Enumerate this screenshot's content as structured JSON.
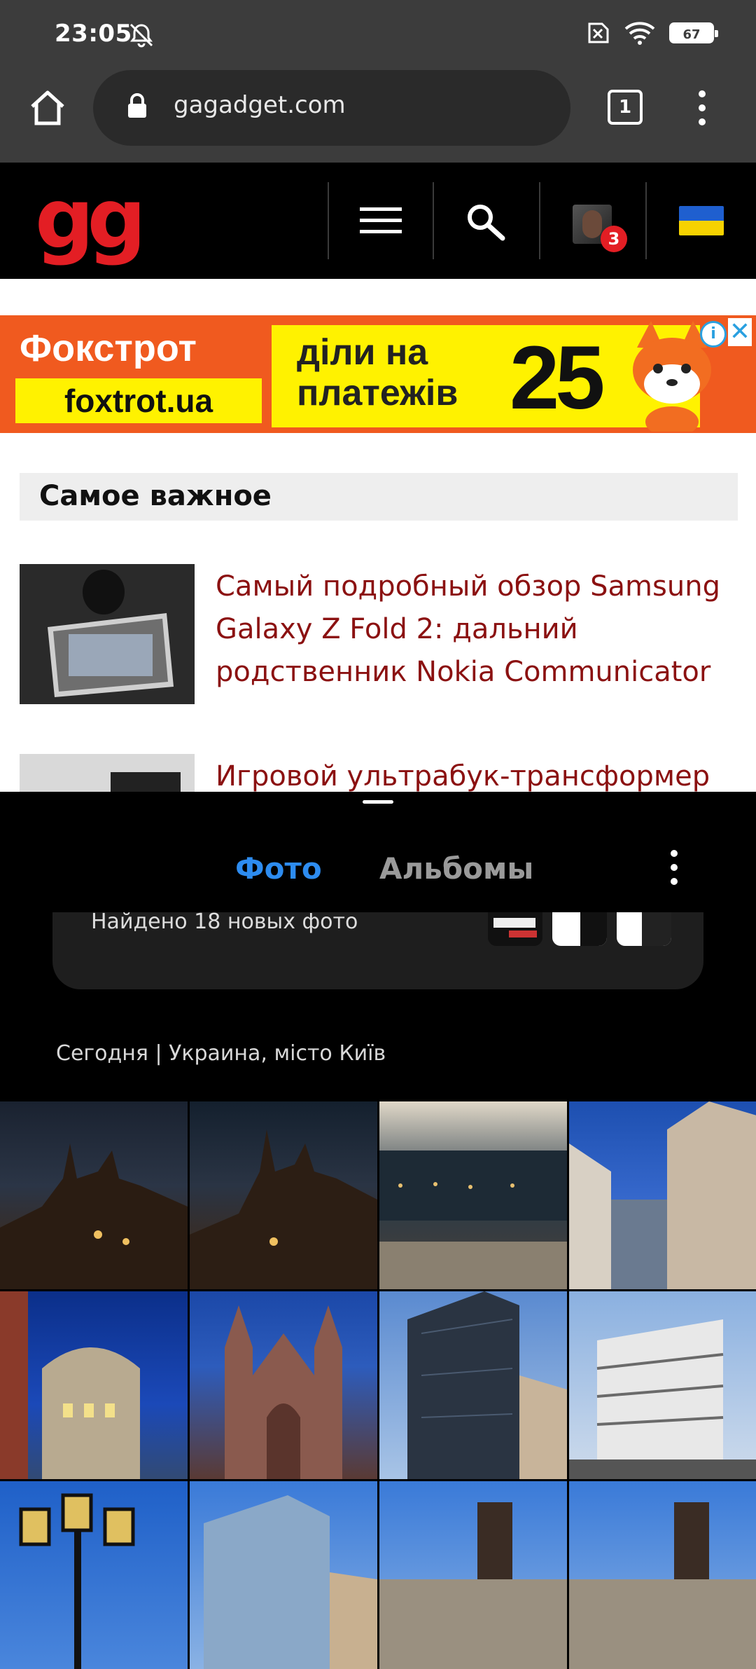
{
  "status_bar": {
    "time": "23:05",
    "battery": "67",
    "icons": [
      "mute-icon",
      "sim-off-icon",
      "wifi-icon",
      "battery-icon"
    ]
  },
  "browser": {
    "url": "gagadget.com",
    "tab_count": "1"
  },
  "site_header": {
    "logo": "gg",
    "notification_count": "3"
  },
  "ad": {
    "brand": "Фокстрот",
    "domain": "foxtrot.ua",
    "slogan_line1": "діли на",
    "slogan_line2": "платежів",
    "number": "25"
  },
  "section": {
    "title": "Самое важное"
  },
  "articles": [
    {
      "title": "Самый подробный обзор Samsung Galaxy Z Fold 2: дальний родственник Nokia Communicator"
    },
    {
      "title": "Игровой ультрабук-трансформер"
    }
  ],
  "gallery": {
    "tabs": [
      {
        "label": "Фото",
        "active": true
      },
      {
        "label": "Альбомы",
        "active": false
      }
    ],
    "banner_text": "Найдено 18 новых фото",
    "date_header": "Сегодня | Украина, місто Київ",
    "colors": {
      "active_tab": "#2d8cf0",
      "inactive_tab": "#9a9a9a"
    }
  },
  "colors": {
    "site_accent": "#e31e24",
    "article_link": "#8b1111",
    "chrome_bg": "#3c3c3c"
  }
}
